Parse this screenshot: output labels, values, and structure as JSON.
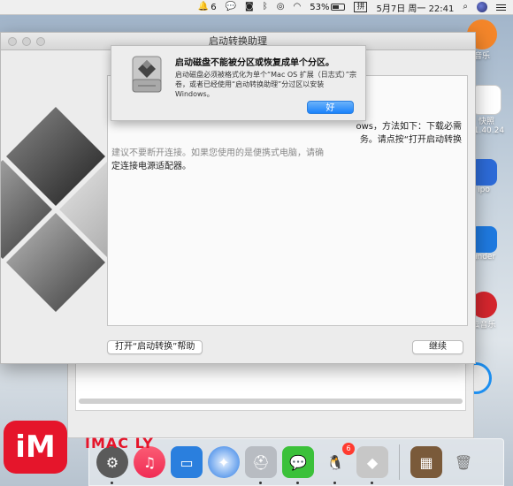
{
  "menubar": {
    "notif_count": "6",
    "battery": "53%",
    "input_method": "拼",
    "date": "5月7日 周一",
    "time": "22:41"
  },
  "desktop": {
    "icons": [
      {
        "label": "音乐"
      },
      {
        "label": "快照"
      },
      {
        "label": "21.40.24"
      },
      {
        "label": "ipo"
      },
      {
        "label": "under"
      },
      {
        "label": "云音乐"
      }
    ]
  },
  "window": {
    "title": "启动转换助理",
    "content_line1_right": "ows，方法如下：下载必需",
    "content_line2_right": "务。请点按“打开启动转换",
    "content_line3_faded": "建议不要断开连接。如果您使用的是便携式电脑，请确",
    "content_line4": "定连接电源适配器。",
    "help_button": "打开“启动转换”帮助",
    "continue_button": "继续"
  },
  "alert": {
    "title": "启动磁盘不能被分区或恢复成单个分区。",
    "message": "启动磁盘必须被格式化为单个“Mac OS 扩展（日志式）”宗卷，或者已经使用“启动转换助理”分过区以安装 Windows。",
    "ok_button": "好"
  },
  "dock": {
    "qq_badge": "6"
  },
  "watermark": {
    "logo": "iM",
    "text": "IMAC LY"
  },
  "colors": {
    "accent": "#1a82fb",
    "badge": "#ff3b30",
    "watermark": "#e5152b"
  }
}
